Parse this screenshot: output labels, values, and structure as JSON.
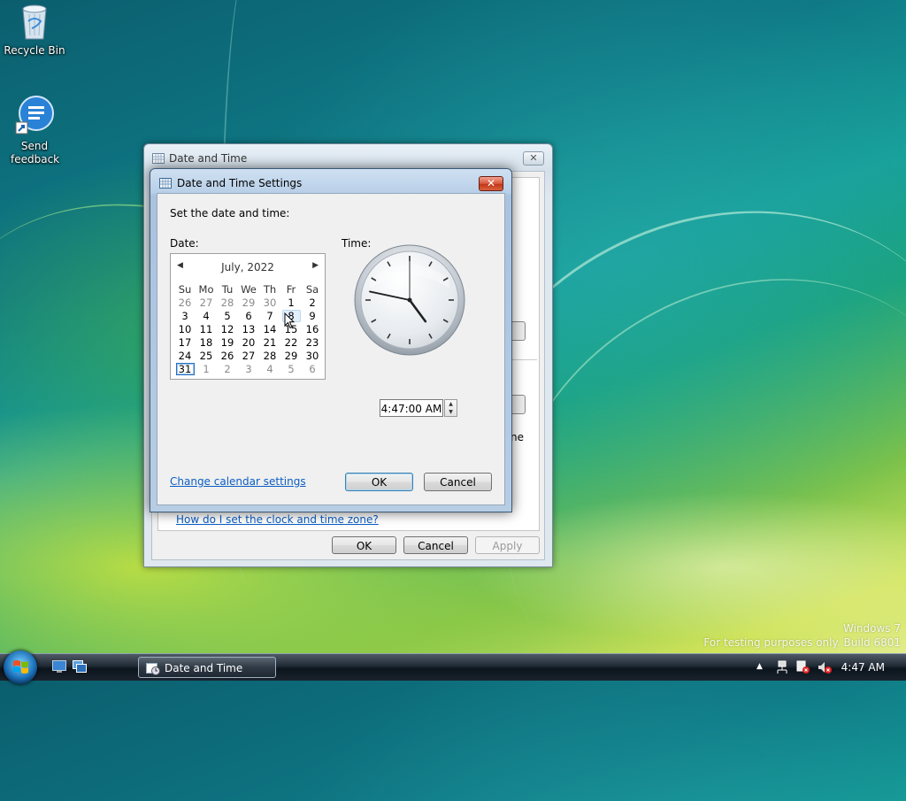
{
  "desktop": {
    "icons": [
      {
        "label": "Recycle Bin",
        "icon": "recycle-bin-icon"
      },
      {
        "label": "Send feedback",
        "icon": "send-feedback-icon"
      }
    ],
    "watermark": {
      "line1": "Windows 7",
      "line2": "For testing purposes only. Build 6801"
    }
  },
  "back_window": {
    "title": "Date and Time",
    "link": "How do I set the clock and time zone?",
    "partial_text": "ne",
    "buttons": {
      "ok": "OK",
      "cancel": "Cancel",
      "apply": "Apply"
    }
  },
  "dialog": {
    "title": "Date and Time Settings",
    "instruction": "Set the date and time:",
    "date_label": "Date:",
    "time_label": "Time:",
    "calendar": {
      "month_year": "July, 2022",
      "weekdays": [
        "Su",
        "Mo",
        "Tu",
        "We",
        "Th",
        "Fr",
        "Sa"
      ],
      "weeks": [
        [
          "26",
          "27",
          "28",
          "29",
          "30",
          "1",
          "2"
        ],
        [
          "3",
          "4",
          "5",
          "6",
          "7",
          "8",
          "9"
        ],
        [
          "10",
          "11",
          "12",
          "13",
          "14",
          "15",
          "16"
        ],
        [
          "17",
          "18",
          "19",
          "20",
          "21",
          "22",
          "23"
        ],
        [
          "24",
          "25",
          "26",
          "27",
          "28",
          "29",
          "30"
        ],
        [
          "31",
          "1",
          "2",
          "3",
          "4",
          "5",
          "6"
        ]
      ],
      "selected_day": "31",
      "hovered_day": "8"
    },
    "clock": {
      "hour": 4,
      "minute": 47,
      "second": 0
    },
    "time_value": "4:47:00 AM",
    "change_calendar_link": "Change calendar settings",
    "buttons": {
      "ok": "OK",
      "cancel": "Cancel"
    }
  },
  "taskbar": {
    "task_button": "Date and Time",
    "clock": "4:47 AM",
    "tray_icons": [
      "show-hidden-icon",
      "network-icon",
      "action-center-icon",
      "volume-muted-icon"
    ]
  }
}
